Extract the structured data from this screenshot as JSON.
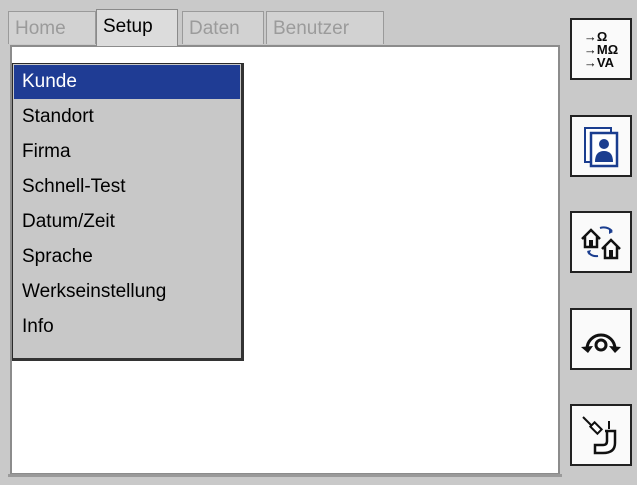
{
  "tabs": [
    {
      "label": "Home",
      "active": false
    },
    {
      "label": "Setup",
      "active": true
    },
    {
      "label": "Daten",
      "active": false
    },
    {
      "label": "Benutzer",
      "active": false
    }
  ],
  "setup_menu": {
    "selected": "Kunde",
    "items": [
      "Kunde",
      "Standort",
      "Firma",
      "Schnell-Test",
      "Datum/Zeit",
      "Sprache",
      "Werkseinstellung",
      "Info"
    ]
  },
  "toolbar": {
    "units": {
      "icon": "units-icon",
      "lines": [
        "→Ω",
        "→MΩ",
        "→VA"
      ]
    },
    "buttons": [
      {
        "icon": "user-cards-icon"
      },
      {
        "icon": "home-transfer-icon"
      },
      {
        "icon": "rotate-icon"
      },
      {
        "icon": "probe-icon"
      }
    ]
  },
  "colors": {
    "background": "#c9c9c9",
    "selection": "#1f3c94",
    "icon_blue": "#1a3d8f"
  }
}
